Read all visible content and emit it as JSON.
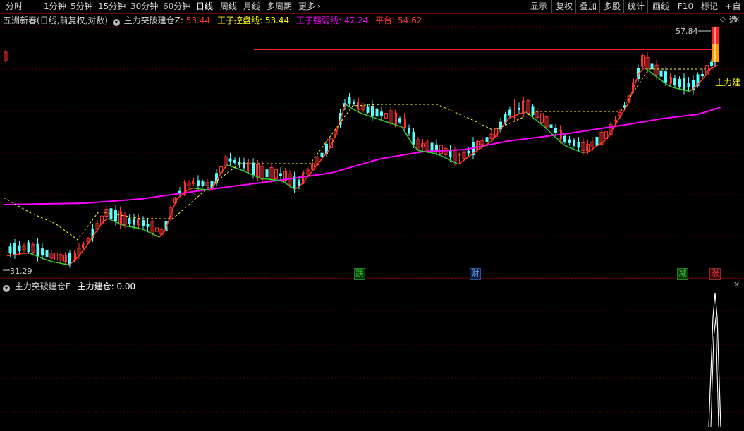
{
  "toolbar": {
    "periods": [
      "分时",
      "1分钟",
      "5分钟",
      "15分钟",
      "30分钟",
      "60分钟",
      "日线",
      "周线",
      "月线",
      "多周期",
      "更多"
    ],
    "active_period": "日线",
    "more_arrow": "›",
    "right_buttons": [
      "显示",
      "复权",
      "叠加",
      "多股",
      "统计",
      "画线",
      "F10",
      "标记",
      "+自选"
    ]
  },
  "main_panel": {
    "stock_title": "五洲新春(日线,前复权,对数)",
    "indicator_name": "主力突破建仓Z",
    "indicator_value": "53.44",
    "items": [
      {
        "label": "王子控盘线",
        "value": "53.44",
        "color": "#ffff00"
      },
      {
        "label": "王子强弱线",
        "value": "47.24",
        "color": "#ff00ff"
      },
      {
        "label": "平台",
        "value": "54.62",
        "color": "#ff3333"
      }
    ],
    "price_high_label": "57.84",
    "price_low_label": "31.29",
    "signal_label": "主力建",
    "markers": [
      {
        "text": "跌",
        "color": "#33cc33"
      },
      {
        "text": "财",
        "color": "#4f9bff"
      },
      {
        "text": "减",
        "color": "#33cc33"
      },
      {
        "text": "涨",
        "color": "#ff3333"
      }
    ]
  },
  "sub_panel": {
    "indicator_name": "主力突破建仓F",
    "item_label": "主力建仓",
    "item_value": "0.00"
  },
  "colors": {
    "up": "#ff3232",
    "down": "#54ffff",
    "strong_line": "#ff00ff",
    "platform": "#ff2020",
    "grid": "#5a0000"
  }
}
